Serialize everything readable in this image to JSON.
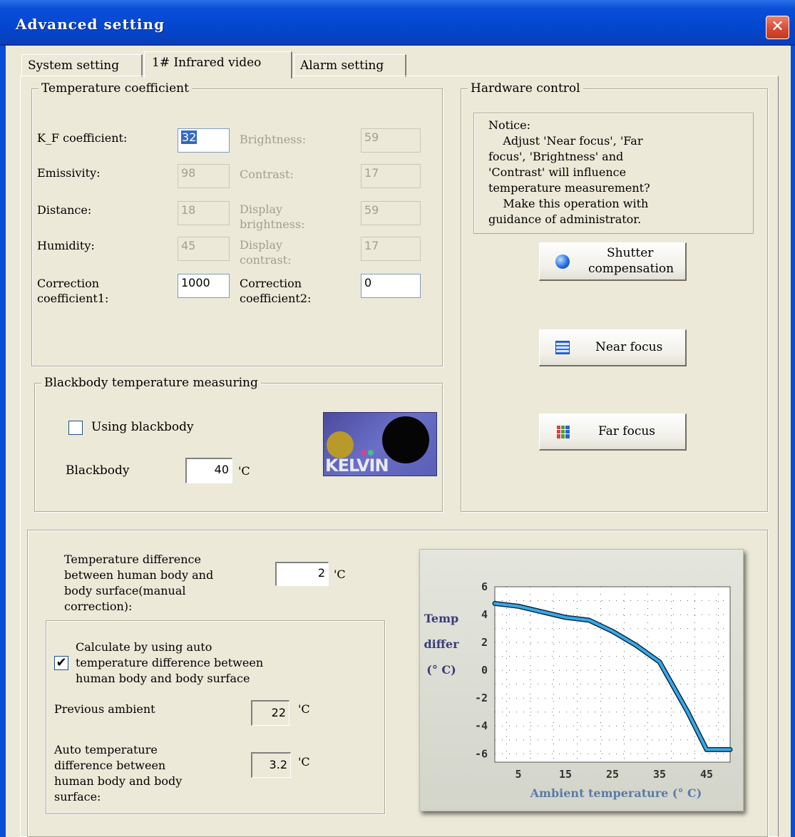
{
  "window": {
    "title": "Advanced setting",
    "close_glyph": "✕"
  },
  "tabs": [
    {
      "label": "System setting",
      "active": false
    },
    {
      "label": "1# Infrared video",
      "active": true
    },
    {
      "label": "Alarm setting",
      "active": false
    }
  ],
  "temperature_coefficient": {
    "title": "Temperature coefficient",
    "kf_label": "K_F coefficient:",
    "kf_value": "32",
    "emissivity_label": "Emissivity:",
    "emissivity_value": "98",
    "distance_label": "Distance:",
    "distance_value": "18",
    "humidity_label": "Humidity:",
    "humidity_value": "45",
    "correction1_label": "Correction coefficient1:",
    "correction1_value": "1000",
    "brightness_label": "Brightness:",
    "brightness_value": "59",
    "contrast_label": "Contrast:",
    "contrast_value": "17",
    "display_brightness_label": "Display brightness:",
    "display_brightness_value": "59",
    "display_contrast_label": "Display contrast:",
    "display_contrast_value": "17",
    "correction2_label": "Correction coefficient2:",
    "correction2_value": "0"
  },
  "blackbody": {
    "title": "Blackbody temperature measuring",
    "using_label": "Using blackbody",
    "using_checked": false,
    "blackbody_label": "Blackbody",
    "blackbody_value": "40",
    "unit": "'C",
    "logo_text": "KELVIN"
  },
  "hardware_control": {
    "title": "Hardware control",
    "notice_lines": [
      "Notice:",
      "    Adjust 'Near focus', 'Far",
      "focus', 'Brightness' and",
      "'Contrast' will influence",
      "temperature measurement?",
      "    Make this operation with",
      "guidance of administrator."
    ],
    "shutter_label_1": "Shutter",
    "shutter_label_2": "compensation",
    "near_focus_label": "Near focus",
    "far_focus_label": "Far focus"
  },
  "manual_correction": {
    "label_lines": [
      "Temperature difference",
      "between human body and",
      "body surface(manual",
      "correction):"
    ],
    "value": "2",
    "unit": "'C"
  },
  "auto_calc": {
    "checkbox_lines": [
      "Calculate by using auto",
      "temperature difference between",
      "human body and body surface"
    ],
    "checked": true,
    "check_glyph": "✔",
    "previous_ambient_label": "Previous ambient",
    "previous_ambient_value": "22",
    "auto_diff_label_lines": [
      "Auto temperature",
      "difference between",
      "human body and body",
      "surface:"
    ],
    "auto_diff_value": "3.2",
    "unit": "'C"
  },
  "chart_data": {
    "type": "line",
    "title": "",
    "ylabel_lines": [
      "Temp",
      "differ",
      "(° C)"
    ],
    "xlabel": "Ambient temperature (° C)",
    "x": [
      0,
      5,
      10,
      15,
      20,
      25,
      30,
      35,
      38,
      41,
      45,
      50
    ],
    "series": [
      {
        "values": [
          4.8,
          4.6,
          4.2,
          3.8,
          3.6,
          2.8,
          1.8,
          0.6,
          -1.2,
          -3.0,
          -5.7,
          -5.7
        ]
      }
    ],
    "xticks": [
      "5",
      "15",
      "25",
      "35",
      "45"
    ],
    "xtick_values": [
      5,
      15,
      25,
      35,
      45
    ],
    "yticks": [
      "6",
      "4",
      "2",
      "0",
      "-2",
      "-4",
      "-6"
    ],
    "ytick_values": [
      6,
      4,
      2,
      0,
      -2,
      -4,
      -6
    ],
    "xlim": [
      0,
      50
    ],
    "ylim": [
      -6.6,
      6
    ],
    "grid": true,
    "line_color": "#39a8e8"
  }
}
